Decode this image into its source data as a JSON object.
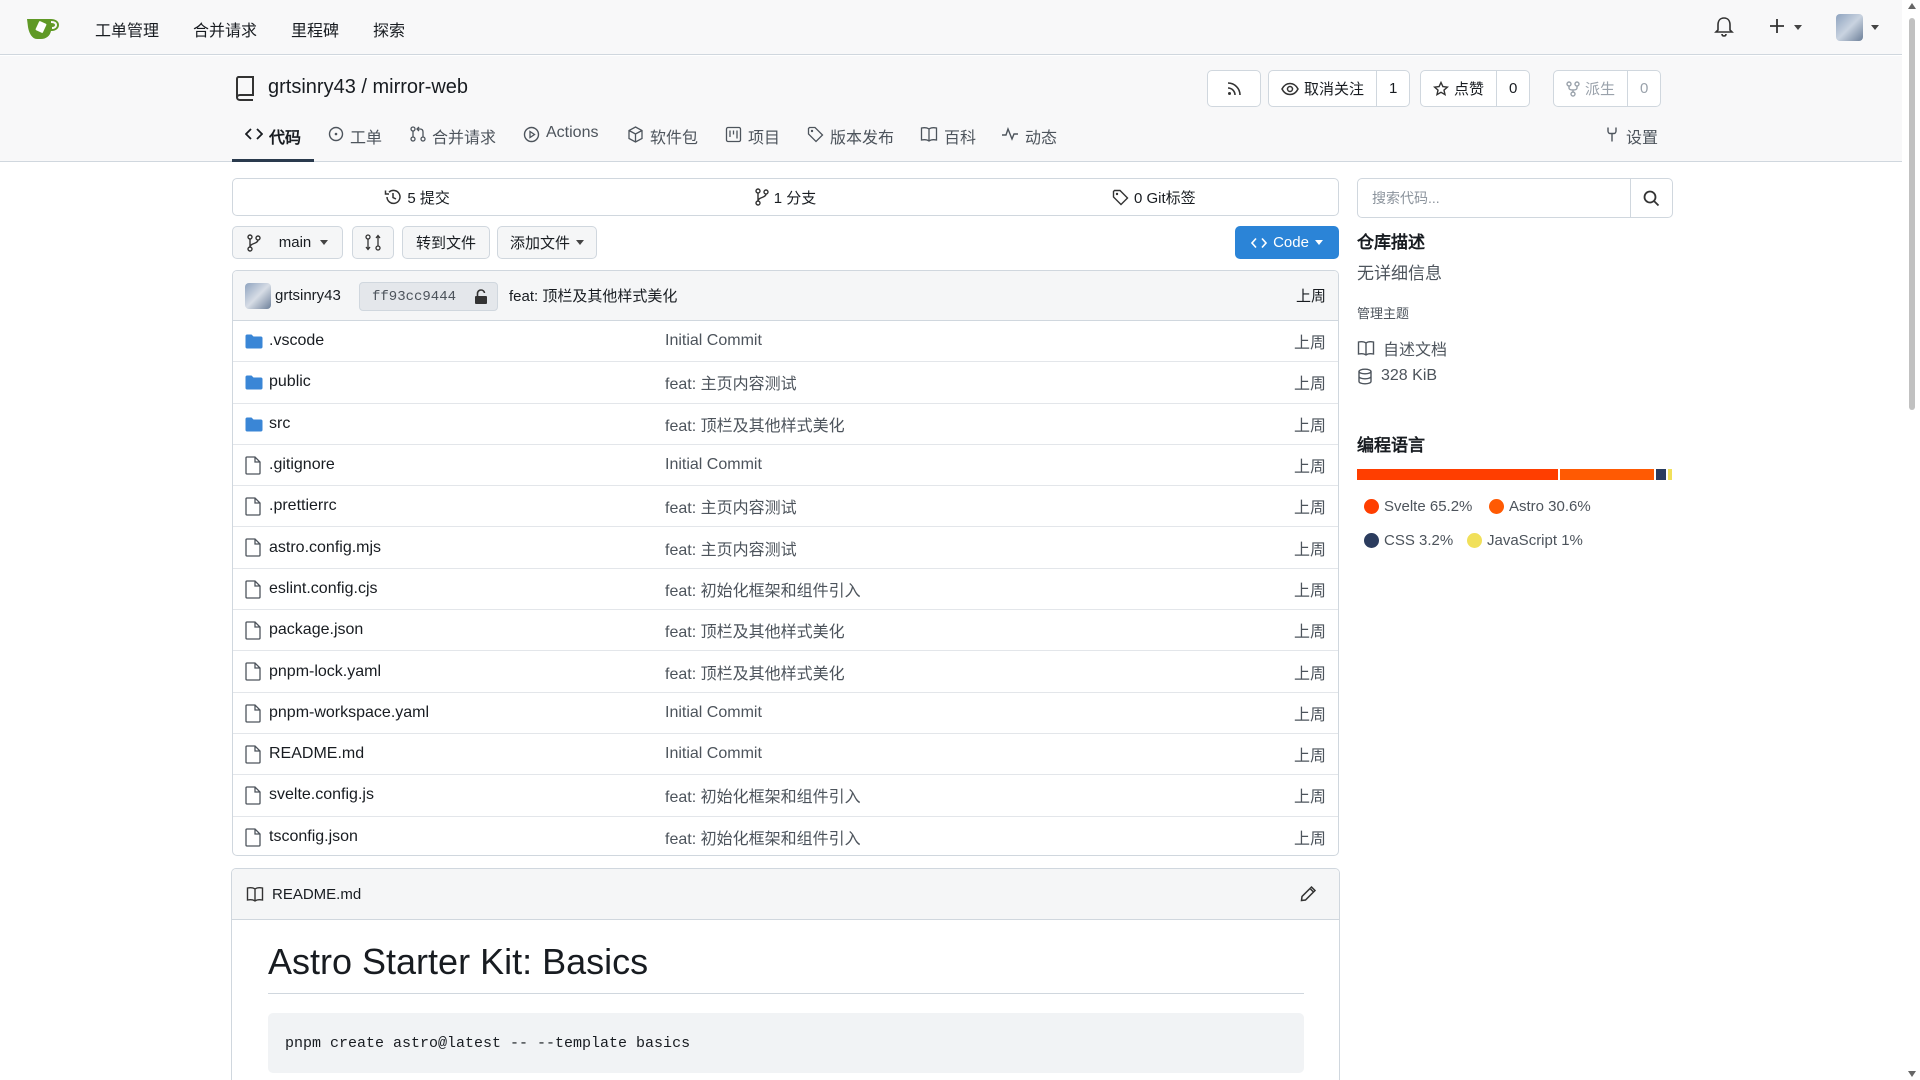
{
  "nav": {
    "items": [
      "工单管理",
      "合并请求",
      "里程碑",
      "探索"
    ]
  },
  "repo": {
    "title": "grtsinry43 / mirror-web",
    "unwatch_label": "取消关注",
    "unwatch_count": "1",
    "star_label": "点赞",
    "star_count": "0",
    "fork_label": "派生",
    "fork_count": "0"
  },
  "tabs": [
    "代码",
    "工单",
    "合并请求",
    "Actions",
    "软件包",
    "项目",
    "版本发布",
    "百科",
    "动态"
  ],
  "settings_label": "设置",
  "stats": {
    "commits": "5 提交",
    "branches": "1 分支",
    "tags": "0 Git标签"
  },
  "toolbar": {
    "branch": "main",
    "goto_file": "转到文件",
    "add_file": "添加文件",
    "code": "Code"
  },
  "latest_commit": {
    "author": "grtsinry43",
    "sha": "ff93cc9444",
    "message": "feat: 顶栏及其他样式美化",
    "time": "上周"
  },
  "files": [
    {
      "name": ".vscode",
      "type": "dir",
      "message": "Initial Commit",
      "time": "上周"
    },
    {
      "name": "public",
      "type": "dir",
      "message": "feat: 主页内容测试",
      "time": "上周"
    },
    {
      "name": "src",
      "type": "dir",
      "message": "feat: 顶栏及其他样式美化",
      "time": "上周"
    },
    {
      "name": ".gitignore",
      "type": "file",
      "message": "Initial Commit",
      "time": "上周"
    },
    {
      "name": ".prettierrc",
      "type": "file",
      "message": "feat: 主页内容测试",
      "time": "上周"
    },
    {
      "name": "astro.config.mjs",
      "type": "file",
      "message": "feat: 主页内容测试",
      "time": "上周"
    },
    {
      "name": "eslint.config.cjs",
      "type": "file",
      "message": "feat: 初始化框架和组件引入",
      "time": "上周"
    },
    {
      "name": "package.json",
      "type": "file",
      "message": "feat: 顶栏及其他样式美化",
      "time": "上周"
    },
    {
      "name": "pnpm-lock.yaml",
      "type": "file",
      "message": "feat: 顶栏及其他样式美化",
      "time": "上周"
    },
    {
      "name": "pnpm-workspace.yaml",
      "type": "file",
      "message": "Initial Commit",
      "time": "上周"
    },
    {
      "name": "README.md",
      "type": "file",
      "message": "Initial Commit",
      "time": "上周"
    },
    {
      "name": "svelte.config.js",
      "type": "file",
      "message": "feat: 初始化框架和组件引入",
      "time": "上周"
    },
    {
      "name": "tsconfig.json",
      "type": "file",
      "message": "feat: 初始化框架和组件引入",
      "time": "上周"
    }
  ],
  "readme": {
    "filename": "README.md",
    "heading": "Astro Starter Kit: Basics",
    "code": "pnpm create astro@latest -- --template basics"
  },
  "sidebar": {
    "search_placeholder": "搜索代码...",
    "desc_title": "仓库描述",
    "desc_text": "无详细信息",
    "topics_label": "管理主题",
    "readme_label": "自述文档",
    "size_label": "328 KiB",
    "lang_title": "编程语言",
    "languages": [
      {
        "name": "Svelte",
        "percent": 65.2,
        "label": "Svelte 65.2%",
        "color": "#ff3e00"
      },
      {
        "name": "Astro",
        "percent": 30.6,
        "label": "Astro 30.6%",
        "color": "#ff5a03"
      },
      {
        "name": "CSS",
        "percent": 3.2,
        "label": "CSS 3.2%",
        "color": "#2b3c5e"
      },
      {
        "name": "JavaScript",
        "percent": 1,
        "label": "JavaScript 1%",
        "color": "#f1e05a"
      }
    ]
  }
}
